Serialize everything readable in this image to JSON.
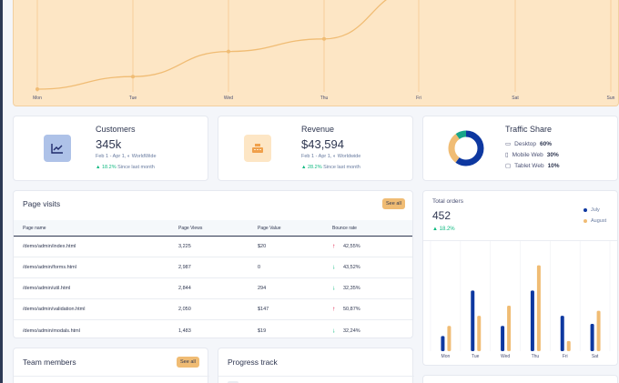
{
  "sales_chart": {
    "x_labels": [
      "Mon",
      "Tue",
      "Wed",
      "Thu",
      "Fri",
      "Sat",
      "Sun"
    ],
    "values": [
      0,
      10,
      30,
      40,
      80,
      98,
      90
    ],
    "colors": {
      "line": "#f0bc74",
      "background": "#fde6c5"
    }
  },
  "customers": {
    "title": "Customers",
    "value": "345k",
    "period": "Feb 1 - Apr 1,",
    "region": "WorldWide",
    "change": "18.2%",
    "change_note": "Since last month",
    "icon": "chart-line-icon"
  },
  "revenue": {
    "title": "Revenue",
    "value": "$43,594",
    "period": "Feb 1 - Apr 1,",
    "region": "Worldwide",
    "change": "28.2%",
    "change_note": "Since last month",
    "icon": "cash-register-icon"
  },
  "traffic_share": {
    "title": "Traffic Share",
    "items": [
      {
        "label": "Desktop",
        "value": "60%",
        "share": 60,
        "color": "#0e38a0",
        "icon": "desktop-icon"
      },
      {
        "label": "Mobile Web",
        "value": "30%",
        "share": 30,
        "color": "#f0bc74",
        "icon": "mobile-icon"
      },
      {
        "label": "Tablet Web",
        "value": "10%",
        "share": 10,
        "color": "#17a589",
        "icon": "tablet-icon"
      }
    ]
  },
  "page_visits": {
    "title": "Page visits",
    "see_all": "See all",
    "columns": [
      "Page name",
      "Page Views",
      "Page Value",
      "Bounce rate"
    ],
    "rows": [
      {
        "page": "/demo/admin/index.html",
        "views": "3,225",
        "value": "$20",
        "bounce": "42,55%",
        "trend": "up"
      },
      {
        "page": "/demo/admin/forms.html",
        "views": "2,987",
        "value": "0",
        "bounce": "43,52%",
        "trend": "down"
      },
      {
        "page": "/demo/admin/util.html",
        "views": "2,844",
        "value": "294",
        "bounce": "32,35%",
        "trend": "down"
      },
      {
        "page": "/demo/admin/validation.html",
        "views": "2,050",
        "value": "$147",
        "bounce": "50,87%",
        "trend": "up"
      },
      {
        "page": "/demo/admin/modals.html",
        "views": "1,483",
        "value": "$19",
        "bounce": "32,24%",
        "trend": "down"
      }
    ]
  },
  "total_orders": {
    "title": "Total orders",
    "value": "452",
    "change": "18.2%",
    "legend": [
      {
        "name": "July",
        "color": "#0e38a0"
      },
      {
        "name": "August",
        "color": "#f0bc74"
      }
    ]
  },
  "chart_data": {
    "type": "bar",
    "categories": [
      "Mon",
      "Tue",
      "Wed",
      "Thu",
      "Fri",
      "Sat"
    ],
    "series": [
      {
        "name": "July",
        "values": [
          15,
          60,
          25,
          60,
          35,
          27
        ]
      },
      {
        "name": "August",
        "values": [
          25,
          35,
          45,
          85,
          10,
          40
        ]
      }
    ],
    "ylim": [
      0,
      100
    ],
    "grid": true,
    "legend_position": "top-right"
  },
  "team_members": {
    "title": "Team members",
    "see_all": "See all"
  },
  "progress_track": {
    "title": "Progress track"
  }
}
